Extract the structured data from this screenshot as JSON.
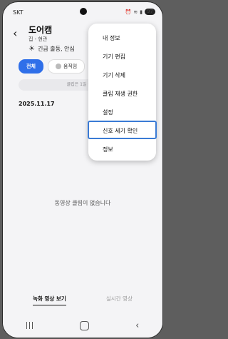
{
  "status_bar": {
    "carrier": "SKT",
    "battery": "97"
  },
  "header": {
    "title": "도어캠",
    "subtitle": "집 - 현관"
  },
  "alert_text": "긴급 출동, 안심",
  "filters": [
    {
      "label": "전체",
      "active": true
    },
    {
      "label": "움직임",
      "active": false
    }
  ],
  "info_banner": "클립은 1일 동안",
  "date_heading": "2025.11.17",
  "empty_message": "동영상 클립이 없습니다",
  "bottom_tabs": [
    {
      "label": "녹화 영상 보기",
      "active": true
    },
    {
      "label": "실시간 영상",
      "active": false
    }
  ],
  "menu": {
    "items": [
      "내 정보",
      "기기 편집",
      "기기 삭제",
      "클립 재생 권한",
      "설정",
      "신호 세기 확인",
      "정보"
    ],
    "highlighted_index": 5,
    "highlight_color": "#3a7bd5"
  },
  "colors": {
    "accent": "#2f6fe9"
  }
}
